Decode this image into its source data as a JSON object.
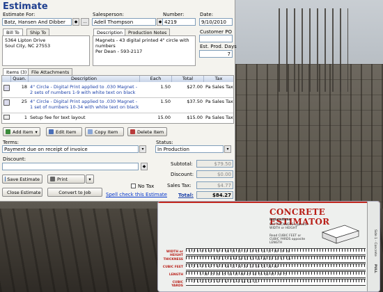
{
  "window": {
    "title": "Estimate"
  },
  "form": {
    "estimate_for_label": "Estimate For:",
    "estimate_for_value": "Batz, Hansen And Dibber",
    "estimate_for_more": "...",
    "salesperson_label": "Salesperson:",
    "salesperson_value": "Adell Thompson",
    "number_label": "Number:",
    "number_value": "4219",
    "date_label": "Date:",
    "date_value": "9/10/2010",
    "customer_po_label": "Customer PO",
    "est_prod_days_label": "Est. Prod. Days",
    "est_prod_days_value": "7"
  },
  "address_tabs": [
    "Bill To",
    "Ship To"
  ],
  "bill_to": "5364 Lipton Drive\nSoul City, NC 27553",
  "desc_tabs": [
    "Description",
    "Production Notes"
  ],
  "description": "Magnets - 43 digital printed 4\" circle with numbers\nPer Dean - 593-2117",
  "item_tabs": [
    "Items (3)",
    "File Attachments"
  ],
  "items_header": {
    "quan": "Quan.",
    "desc": "Description",
    "each": "Each",
    "total": "Total",
    "tax": "Tax"
  },
  "items": [
    {
      "quan": "18",
      "desc": "4\" Circle - Digital Print applied to .030 Magnet - 2 sets of numbers 1-9 with white text on black",
      "each": "1.50",
      "total": "$27.00",
      "tax": "Pa Sales Tax",
      "color": "#1a3fa8"
    },
    {
      "quan": "25",
      "desc": "4\" Circle - Digital Print applied to .030 Magnet - 1 set of numbers 10-34 with white text on black",
      "each": "1.50",
      "total": "$37.50",
      "tax": "Pa Sales Tax",
      "color": "#1a3fa8"
    },
    {
      "quan": "1",
      "desc": "Setup fee for text layout",
      "each": "15.00",
      "total": "$15.00",
      "tax": "Pa Sales Tax",
      "color": "#000000"
    }
  ],
  "item_buttons": {
    "add": "Add Item",
    "edit": "Edit Item",
    "copy": "Copy Item",
    "delete": "Delete Item"
  },
  "terms": {
    "label": "Terms:",
    "value": "Payment due on receipt of invoice"
  },
  "status": {
    "label": "Status:",
    "value": "In Production"
  },
  "discount": {
    "label": "Discount:"
  },
  "totals": {
    "subtotal_label": "Subtotal:",
    "subtotal": "$79.50",
    "discount_label": "Discount:",
    "discount": "$0.00",
    "tax_label": "Sales Tax:",
    "tax": "$4.77",
    "total_label": "Total:",
    "total": "$84.27"
  },
  "no_tax_label": "No Tax",
  "buttons": {
    "save": "Save Estimate",
    "print": "Print",
    "close": "Close Estimate",
    "convert": "Convert to Job",
    "spell": "Spell check this Estimate"
  },
  "card": {
    "title": "CONCRETE ESTIMATOR",
    "instructions_label": "Instructions",
    "step1": "Set THICKNESS opposite WIDTH or HEIGHT",
    "step2": "Read CUBIC FEET or CUBIC YARDS opposite LENGTH",
    "rows": [
      "WIDTH or HEIGHT",
      "THICKNESS",
      "CUBIC FEET",
      "LENGTH",
      "CUBIC YARDS"
    ],
    "row_numbers": [
      "1  2  3  4  5  6  7  8  9  10  11  12  13  14  15  16  17  18  19  20",
      "4  5  6  7  8  9  10  11  12  13  14  15  16  17  18",
      "1  2  3  4  5  6  7  8  9  10  12  14  16  18  20  24  30  40",
      "5  10  15  20  25  30  35  40  45  50  55  60  65  70  75",
      "5  1  1.5  2  3  4  5  6  7  8  9  10  12  15"
    ],
    "side_label": "Side 1 - Concrete",
    "pull_label": "PULL",
    "accent": "#b81d16"
  }
}
